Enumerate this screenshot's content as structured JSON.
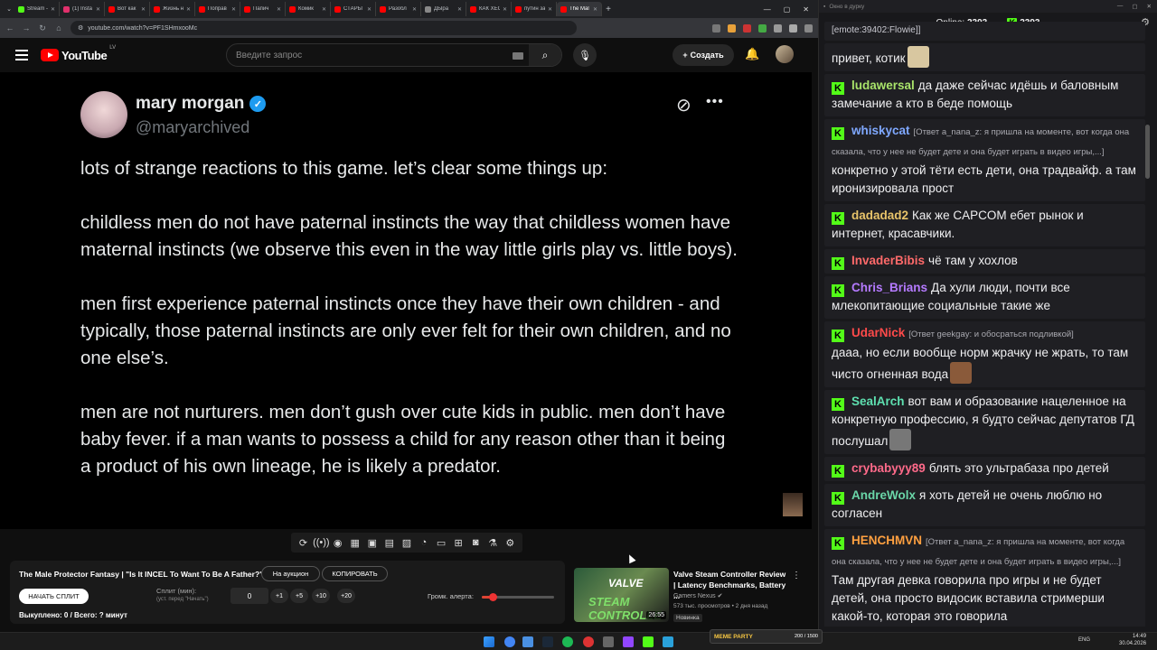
{
  "browser": {
    "tabs": [
      {
        "label": "Stream -",
        "color": "#53fc18"
      },
      {
        "label": "(1) Insta",
        "color": "#e1306c"
      },
      {
        "label": "Вот как",
        "color": "#ff0000"
      },
      {
        "label": "Жизнь н",
        "color": "#ff0000"
      },
      {
        "label": "Поправ",
        "color": "#ff0000"
      },
      {
        "label": "Папич",
        "color": "#ff0000"
      },
      {
        "label": "Комик",
        "color": "#ff0000"
      },
      {
        "label": "СТАРЫ",
        "color": "#ff0000"
      },
      {
        "label": "Разобл",
        "color": "#ff0000"
      },
      {
        "label": "ДЫра",
        "color": "#888888"
      },
      {
        "label": "КАК ХЕС",
        "color": "#ff0000"
      },
      {
        "label": "путин за",
        "color": "#ff0000"
      },
      {
        "label": "The Mal",
        "color": "#ff0000"
      }
    ],
    "url": "youtube.com/watch?v=PF1SHmxooMc"
  },
  "youtube": {
    "logo": "YouTube",
    "country": "LV",
    "search_placeholder": "Введите запрос",
    "create_label": "Создать"
  },
  "tweet": {
    "name": "mary morgan",
    "handle": "@maryarchived",
    "paragraphs": [
      "lots of strange reactions to this game. let’s clear some things up:",
      "childless men do not have paternal instincts the way that childless women have maternal instincts (we observe this even in the way little girls play vs. little boys).",
      "men first experience paternal instincts once they have their own children - and typically, those paternal instincts are only ever felt for their own children, and no one else’s.",
      "men are not nurturers. men don’t gush over cute kids in public. men don’t have baby fever. if a man wants to possess a child for any reason other than it being a product of his own lineage, he is likely a predator."
    ]
  },
  "panel": {
    "title": "The Male Protector Fantasy | \"Is It INCEL To Want To Be A Father?\"",
    "auction_label": "На аукцион",
    "copy_label": "КОПИРОВАТЬ",
    "start_label": "НАЧАТЬ СПЛИТ",
    "split_label": "Сплит (мин):",
    "split_hint": "(уст. перед \"Начать\")",
    "split_value": "0",
    "steps": [
      "+1",
      "+5",
      "+10",
      "+20"
    ],
    "volume_label": "Громк. алерта:",
    "volume_level": 0.15,
    "status": "Выкуплено: 0 / Всего: ? минут"
  },
  "recommended": {
    "thumb_text_1": "VALVE",
    "thumb_text_2": "STEAM CONTROLLE",
    "duration": "26:55",
    "title": "Valve Steam Controller Review | Latency Benchmarks, Battery ...",
    "channel": "Gamers Nexus",
    "meta": "573 тыс. просмотров • 2 дня назад",
    "badge": "Новинка"
  },
  "chat": {
    "window_title": "Окно в дурку",
    "online_label": "Online:",
    "online_count": "2393",
    "viewer_count": "2393",
    "messages": [
      {
        "user": "",
        "color": "#ff7a7a",
        "reply": "",
        "text": "[emote:39402:Flowie]]",
        "small": true
      },
      {
        "user": "",
        "color": "#ff7a7a",
        "reply": "",
        "text": "привет, котик",
        "emote": "#d8c7a0"
      },
      {
        "user": "ludawersal",
        "color": "#a8e36a",
        "reply": "",
        "text": "да даже сейчас идёшь и баловным замечание а кто в беде помощь"
      },
      {
        "user": "whiskycat",
        "color": "#7fa8ff",
        "reply": "[Ответ a_nana_z: я пришла на моменте, вот когда она сказала, что у нее не будет дете и она будет играть в видео игры,...]",
        "text": "конкретно у этой тёти есть дети, она традвайф. а там иронизировала прост"
      },
      {
        "user": "dadadad2",
        "color": "#e8c46a",
        "reply": "",
        "text": "Как же CAPCOM ебет рынок и интернет, красавчики."
      },
      {
        "user": "InvaderBibis",
        "color": "#ff6a6a",
        "reply": "",
        "text": "чё там у хохлов"
      },
      {
        "user": "Chris_Brians",
        "color": "#b57aff",
        "reply": "",
        "text": "Да хули люди, почти все млекопитающие социальные такие же"
      },
      {
        "user": "UdarNick",
        "color": "#ff4a4a",
        "reply": "[Ответ geekgay: и обосраться подливкой]",
        "text": "дааа, но если вообще норм жрачку не жрать, то там чисто огненная вода",
        "emote": "#8a5a3a"
      },
      {
        "user": "SealArch",
        "color": "#5ee0b0",
        "reply": "",
        "text": "вот вам и образование нацеленное на конкретную профессию, я будто сейчас депутатов ГД послушал",
        "emote": "#777777"
      },
      {
        "user": "crybabyyy89",
        "color": "#ff6a8a",
        "reply": "",
        "text": "блять это ультрабаза про детей"
      },
      {
        "user": "AndreWolx",
        "color": "#6ad6a8",
        "reply": "",
        "text": "я хоть детей не очень люблю но согласен"
      },
      {
        "user": "HENCHMVN",
        "color": "#ffa040",
        "reply": "[Ответ a_nana_z: я пришла на моменте, вот когда она сказала, что у нее не будет дете и она будет играть в видео игры,...]",
        "text": "Там другая девка говорила про игры и не будет детей, она просто видосик вставила стримерши какой-то, которая это говорила"
      }
    ]
  },
  "taskbar": {
    "media_title": "MEME PARTY",
    "media_count": "200 / 1500",
    "lang": "ENG",
    "time": "14:49",
    "date": "30.04.2026"
  }
}
